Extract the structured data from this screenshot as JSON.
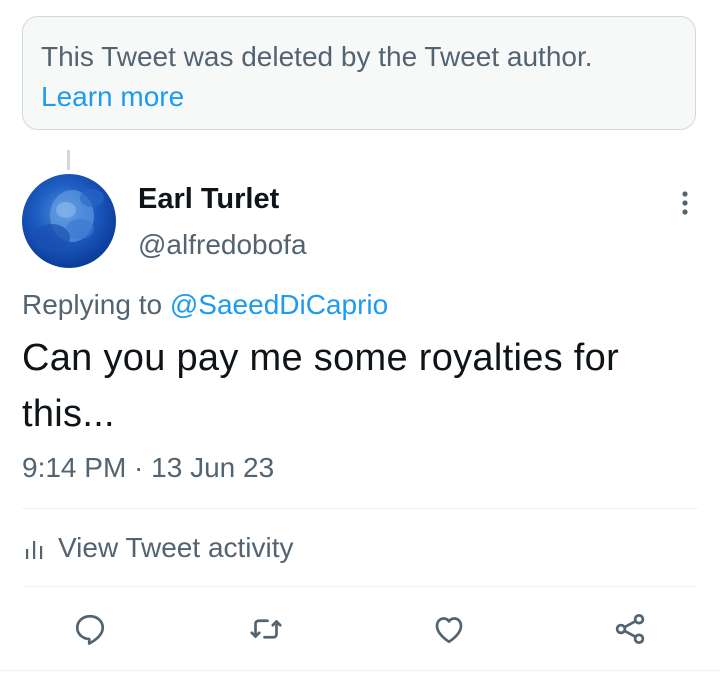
{
  "deleted_notice": {
    "message": "This Tweet was deleted by the Tweet author.",
    "learn_more": "Learn more"
  },
  "author": {
    "display_name": "Earl Turlet",
    "handle": "@alfredobofa"
  },
  "reply_context": {
    "prefix": "Replying to ",
    "mention": "@SaeedDiCaprio"
  },
  "tweet": {
    "text": "Can you pay me some royalties for this...",
    "timestamp": "9:14 PM · 13 Jun 23"
  },
  "activity": {
    "label": "View Tweet activity"
  },
  "actions": {
    "reply_icon": "reply-icon",
    "retweet_icon": "retweet-icon",
    "like_icon": "heart-icon",
    "share_icon": "share-icon"
  },
  "colors": {
    "link": "#1d9bf0",
    "secondary_text": "#536471",
    "primary_text": "#0f1419",
    "border": "#cfd9de"
  }
}
